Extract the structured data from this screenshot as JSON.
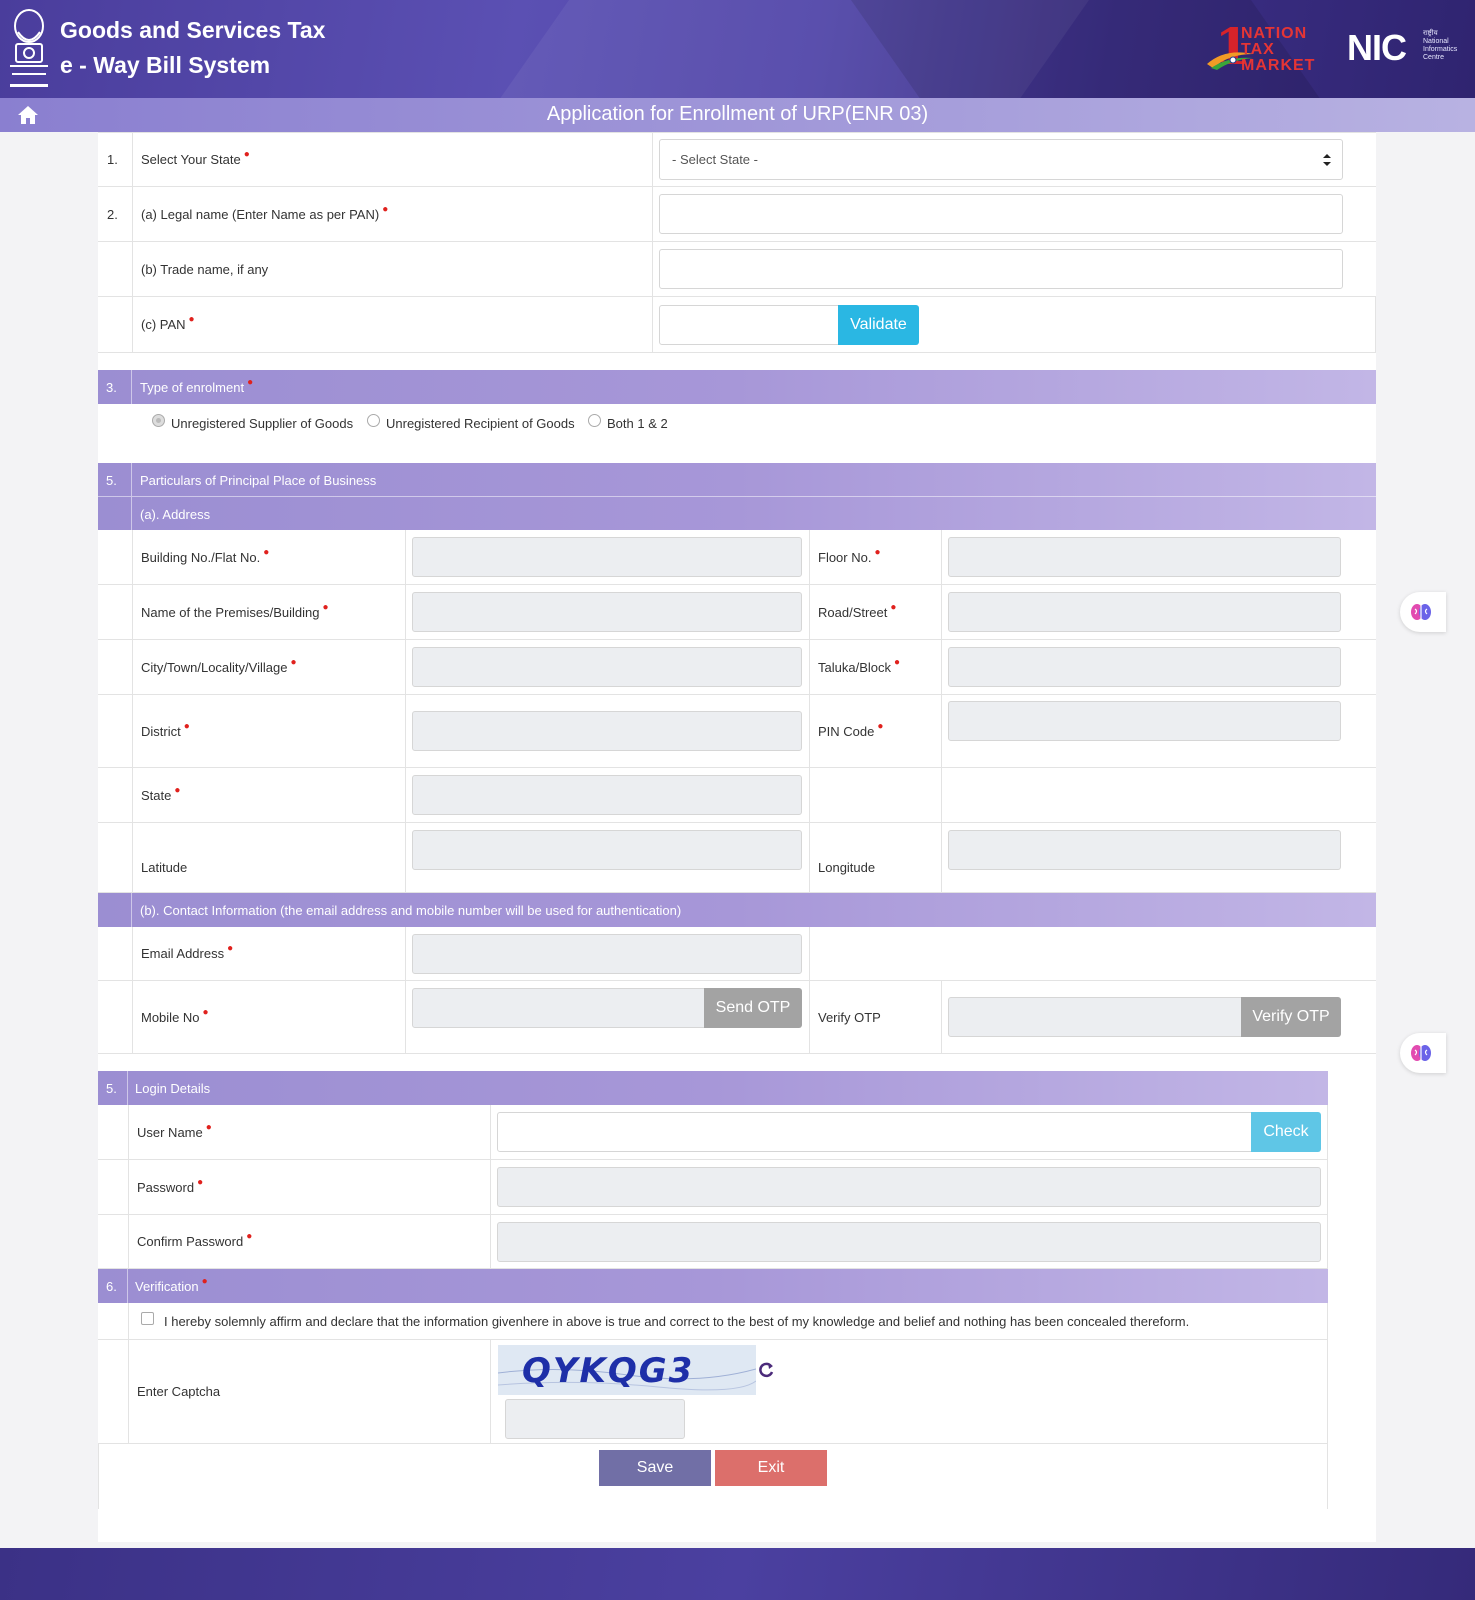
{
  "header": {
    "title_line1": "Goods and Services Tax",
    "title_line2": "e - Way Bill System",
    "partner_logo_number": "1",
    "partner_logo_line1": "NATION",
    "partner_logo_line2": "TAX",
    "partner_logo_line3": "MARKET",
    "nic_logo": "NIC",
    "nic_hindi": "राष्ट्रीय",
    "nic_subtitle_1": "National",
    "nic_subtitle_2": "Informatics",
    "nic_subtitle_3": "Centre"
  },
  "page_title": "Application for Enrollment of URP(ENR 03)",
  "state_row": {
    "num": "1.",
    "label": "Select Your State",
    "selected": "- Select State -"
  },
  "legal_name": {
    "num": "2.",
    "label": "(a) Legal name (Enter Name as per PAN)"
  },
  "trade_name": {
    "label": "(b) Trade name, if any"
  },
  "pan": {
    "label": "(c) PAN",
    "validate_label": "Validate"
  },
  "enrolment": {
    "num": "3.",
    "title": "Type of enrolment",
    "options": [
      "Unregistered Supplier of Goods",
      "Unregistered Recipient of Goods",
      "Both 1 & 2"
    ],
    "selected_index": 0
  },
  "business": {
    "num": "5.",
    "title": "Particulars of Principal Place of Business",
    "address_title": "(a). Address",
    "fields": {
      "building": "Building No./Flat No.",
      "floor": "Floor No.",
      "premises": "Name of the Premises/Building",
      "road": "Road/Street",
      "city": "City/Town/Locality/Village",
      "taluka": "Taluka/Block",
      "district": "District",
      "pin": "PIN Code",
      "state": "State",
      "latitude": "Latitude",
      "longitude": "Longitude"
    },
    "contact_title": "(b). Contact Information (the email address and mobile number will be used for authentication)",
    "email": "Email Address",
    "mobile": "Mobile No",
    "send_otp": "Send OTP",
    "verify_otp_label": "Verify OTP",
    "verify_otp_button": "Verify OTP"
  },
  "login": {
    "num": "5.",
    "title": "Login Details",
    "username": "User Name",
    "check": "Check",
    "password": "Password",
    "confirm_password": "Confirm Password"
  },
  "verification": {
    "num": "6.",
    "title": "Verification",
    "declaration": "I hereby solemnly affirm and declare that the information givenhere in above is true and correct to the best of my knowledge and belief and nothing has been concealed thereform.",
    "captcha_label": "Enter Captcha",
    "captcha_text": "QYKQG3"
  },
  "actions": {
    "save": "Save",
    "exit": "Exit"
  },
  "colors": {
    "section_bar": "#a797d8",
    "validate_button": "#2ab7e3",
    "save_button": "#716fa6",
    "exit_button": "#dc6f6b",
    "required": "#e0211d"
  },
  "icons": [
    "home-icon",
    "select-caret-icon",
    "refresh-captcha-icon",
    "brain-icon"
  ]
}
